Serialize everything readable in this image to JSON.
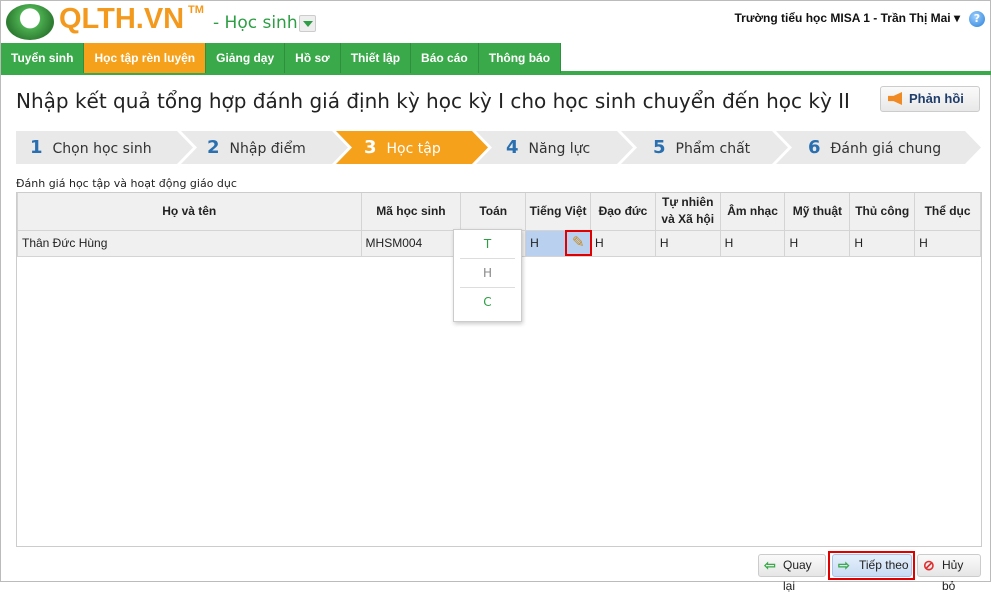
{
  "header": {
    "logo": "QLTH.VN",
    "tm": "TM",
    "role": "- Học sinh",
    "user": "Trường tiểu học MISA 1 - Trần Thị Mai",
    "help": "?"
  },
  "nav": [
    "Tuyển sinh",
    "Học tập rèn luyện",
    "Giảng dạy",
    "Hồ sơ",
    "Thiết lập",
    "Báo cáo",
    "Thông báo"
  ],
  "page_title": "Nhập kết quả tổng hợp đánh giá định kỳ học kỳ I cho học sinh chuyển đến học kỳ II",
  "feedback_label": "Phản hồi",
  "steps": [
    {
      "num": "1",
      "label": "Chọn học sinh"
    },
    {
      "num": "2",
      "label": "Nhập điểm"
    },
    {
      "num": "3",
      "label": "Học tập"
    },
    {
      "num": "4",
      "label": "Năng lực"
    },
    {
      "num": "5",
      "label": "Phẩm chất"
    },
    {
      "num": "6",
      "label": "Đánh giá chung"
    }
  ],
  "section_label": "Đánh giá học tập và hoạt động giáo dục",
  "columns": [
    "Họ và tên",
    "Mã học sinh",
    "Toán",
    "Tiếng Việt",
    "Đạo đức",
    "Tự nhiên và Xã hội",
    "Âm nhạc",
    "Mỹ thuật",
    "Thủ công",
    "Thể dục"
  ],
  "rows": [
    {
      "name": "Thân Đức Hùng",
      "code": "MHSM004",
      "toan": "",
      "tv": "H",
      "dd": "H",
      "tnxh": "H",
      "an": "H",
      "mt": "H",
      "tc": "H",
      "td": "H"
    }
  ],
  "popup_options": [
    "T",
    "H",
    "C"
  ],
  "buttons": {
    "back": "Quay lại",
    "next": "Tiếp theo",
    "cancel": "Hủy bỏ"
  }
}
